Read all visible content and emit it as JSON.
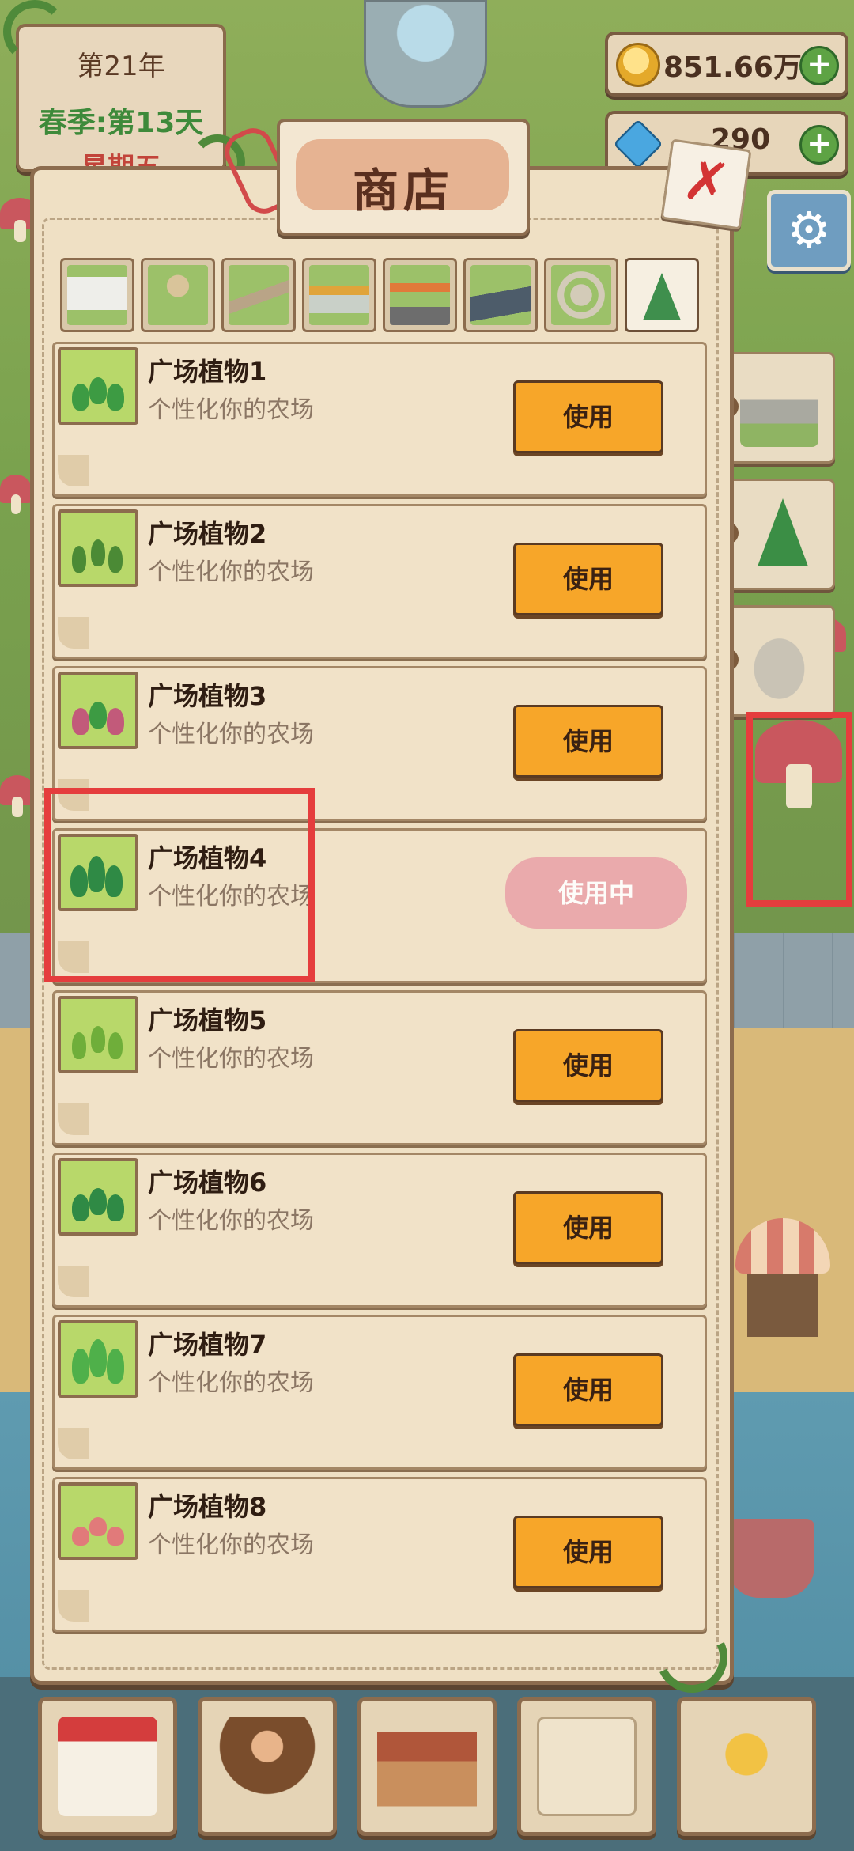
{
  "hud": {
    "year": "第21年",
    "season_day": "春季:第13天",
    "weekday": "星期五",
    "coins": "851.66万",
    "gems": "290",
    "coin_icon": "coin-icon",
    "gem_icon": "gem-icon",
    "plus_symbol": "+"
  },
  "shop": {
    "title": "商店",
    "close_symbol": "✗",
    "categories": [
      "fence",
      "path-garden",
      "road",
      "flower-bed",
      "vegetable-bed",
      "street",
      "plaza",
      "plant"
    ],
    "active_category": "plant",
    "items": [
      {
        "name": "广场植物1",
        "desc": "个性化你的农场",
        "action": "使用"
      },
      {
        "name": "广场植物2",
        "desc": "个性化你的农场",
        "action": "使用"
      },
      {
        "name": "广场植物3",
        "desc": "个性化你的农场",
        "action": "使用"
      },
      {
        "name": "广场植物4",
        "desc": "个性化你的农场",
        "action": "使用中"
      },
      {
        "name": "广场植物5",
        "desc": "个性化你的农场",
        "action": "使用"
      },
      {
        "name": "广场植物6",
        "desc": "个性化你的农场",
        "action": "使用"
      },
      {
        "name": "广场植物7",
        "desc": "个性化你的农场",
        "action": "使用"
      },
      {
        "name": "广场植物8",
        "desc": "个性化你的农场",
        "action": "使用"
      }
    ]
  },
  "side_tabs": [
    "fence-decor",
    "christmas-tree",
    "fountain-plaza"
  ],
  "settings_icon": "gear-icon",
  "bottom_nav": [
    "calendar",
    "farmer",
    "house",
    "letter",
    "achievement-medal"
  ],
  "colors": {
    "button_orange": "#f7a629",
    "in_use_pink": "#eaa4aa",
    "highlight_red": "#e53d3d",
    "panel_paper": "#efe0c4"
  }
}
